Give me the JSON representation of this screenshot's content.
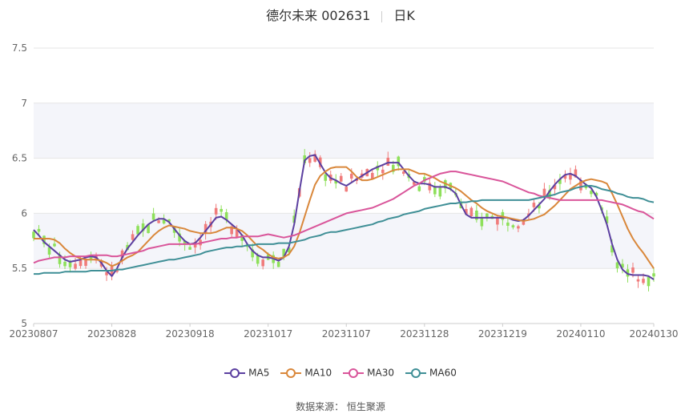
{
  "title": {
    "name": "德尔未来 002631",
    "period": "日K"
  },
  "source": "数据来源： 恒生聚源",
  "colors": {
    "up": "#f07b7b",
    "down": "#8ee05a",
    "grid": "#e6e6e6",
    "band": "#f4f5fa"
  },
  "chart_data": {
    "type": "candlestick",
    "ylim": [
      5,
      7.5
    ],
    "yticks": [
      "5",
      "5.5",
      "6",
      "6.5",
      "7",
      "7.5"
    ],
    "xtick_labels": [
      "20230807",
      "20230828",
      "20230918",
      "20231017",
      "20231107",
      "20231128",
      "20231219",
      "20240110",
      "20240130"
    ],
    "xtick_index": [
      0,
      15,
      30,
      45,
      60,
      75,
      90,
      105,
      119
    ],
    "count": 120,
    "series": [
      {
        "name": "MA5",
        "color": "#5b3fa0",
        "values": [
          5.85,
          5.8,
          5.74,
          5.7,
          5.66,
          5.62,
          5.58,
          5.56,
          5.57,
          5.58,
          5.6,
          5.61,
          5.6,
          5.55,
          5.48,
          5.43,
          5.5,
          5.6,
          5.68,
          5.74,
          5.8,
          5.85,
          5.9,
          5.93,
          5.95,
          5.95,
          5.92,
          5.86,
          5.8,
          5.75,
          5.72,
          5.73,
          5.78,
          5.84,
          5.9,
          5.96,
          5.97,
          5.94,
          5.9,
          5.86,
          5.8,
          5.72,
          5.66,
          5.62,
          5.6,
          5.6,
          5.59,
          5.57,
          5.6,
          5.7,
          5.9,
          6.2,
          6.48,
          6.52,
          6.53,
          6.45,
          6.37,
          6.32,
          6.3,
          6.27,
          6.25,
          6.28,
          6.31,
          6.34,
          6.37,
          6.4,
          6.42,
          6.44,
          6.46,
          6.46,
          6.46,
          6.4,
          6.34,
          6.29,
          6.27,
          6.27,
          6.26,
          6.24,
          6.24,
          6.24,
          6.22,
          6.18,
          6.08,
          5.99,
          5.96,
          5.96,
          5.96,
          5.96,
          5.96,
          5.96,
          5.96,
          5.96,
          5.94,
          5.93,
          5.94,
          5.98,
          6.03,
          6.08,
          6.13,
          6.2,
          6.26,
          6.31,
          6.35,
          6.36,
          6.34,
          6.3,
          6.26,
          6.23,
          6.15,
          6.03,
          5.9,
          5.72,
          5.58,
          5.49,
          5.45,
          5.44,
          5.44,
          5.44,
          5.43,
          5.4
        ]
      },
      {
        "name": "MA10",
        "color": "#d9873a",
        "values": [
          5.77,
          5.77,
          5.77,
          5.77,
          5.76,
          5.73,
          5.68,
          5.64,
          5.61,
          5.59,
          5.58,
          5.58,
          5.58,
          5.57,
          5.55,
          5.52,
          5.54,
          5.57,
          5.6,
          5.62,
          5.65,
          5.7,
          5.75,
          5.8,
          5.84,
          5.87,
          5.89,
          5.88,
          5.87,
          5.86,
          5.84,
          5.83,
          5.82,
          5.82,
          5.82,
          5.83,
          5.85,
          5.87,
          5.87,
          5.86,
          5.84,
          5.8,
          5.75,
          5.7,
          5.67,
          5.63,
          5.6,
          5.59,
          5.6,
          5.63,
          5.7,
          5.82,
          5.97,
          6.12,
          6.26,
          6.34,
          6.38,
          6.41,
          6.42,
          6.42,
          6.42,
          6.38,
          6.33,
          6.3,
          6.3,
          6.31,
          6.33,
          6.35,
          6.37,
          6.39,
          6.4,
          6.4,
          6.4,
          6.38,
          6.36,
          6.36,
          6.34,
          6.32,
          6.29,
          6.27,
          6.25,
          6.23,
          6.2,
          6.16,
          6.12,
          6.09,
          6.05,
          6.02,
          6.0,
          5.98,
          5.97,
          5.96,
          5.95,
          5.94,
          5.93,
          5.94,
          5.95,
          5.97,
          5.99,
          6.03,
          6.07,
          6.12,
          6.17,
          6.22,
          6.25,
          6.28,
          6.3,
          6.31,
          6.3,
          6.29,
          6.27,
          6.18,
          6.08,
          5.97,
          5.86,
          5.77,
          5.7,
          5.64,
          5.57,
          5.5
        ]
      },
      {
        "name": "MA30",
        "color": "#d9559a",
        "values": [
          5.55,
          5.57,
          5.58,
          5.59,
          5.6,
          5.6,
          5.6,
          5.61,
          5.61,
          5.61,
          5.61,
          5.62,
          5.62,
          5.62,
          5.62,
          5.61,
          5.61,
          5.62,
          5.63,
          5.64,
          5.65,
          5.66,
          5.68,
          5.69,
          5.7,
          5.71,
          5.72,
          5.72,
          5.72,
          5.72,
          5.72,
          5.72,
          5.73,
          5.74,
          5.75,
          5.76,
          5.77,
          5.77,
          5.78,
          5.78,
          5.79,
          5.79,
          5.79,
          5.79,
          5.8,
          5.81,
          5.8,
          5.79,
          5.78,
          5.79,
          5.8,
          5.82,
          5.84,
          5.86,
          5.88,
          5.9,
          5.92,
          5.94,
          5.96,
          5.98,
          6.0,
          6.01,
          6.02,
          6.03,
          6.04,
          6.05,
          6.07,
          6.09,
          6.11,
          6.13,
          6.16,
          6.19,
          6.22,
          6.25,
          6.27,
          6.3,
          6.32,
          6.34,
          6.36,
          6.37,
          6.38,
          6.38,
          6.37,
          6.36,
          6.35,
          6.34,
          6.33,
          6.32,
          6.31,
          6.3,
          6.29,
          6.27,
          6.25,
          6.23,
          6.21,
          6.19,
          6.18,
          6.16,
          6.15,
          6.14,
          6.13,
          6.12,
          6.12,
          6.12,
          6.12,
          6.12,
          6.12,
          6.12,
          6.12,
          6.12,
          6.11,
          6.1,
          6.09,
          6.08,
          6.06,
          6.04,
          6.02,
          6.01,
          5.98,
          5.95
        ]
      },
      {
        "name": "MA60",
        "color": "#3f8f96",
        "values": [
          5.45,
          5.45,
          5.46,
          5.46,
          5.46,
          5.46,
          5.47,
          5.47,
          5.47,
          5.47,
          5.47,
          5.48,
          5.48,
          5.48,
          5.48,
          5.48,
          5.49,
          5.49,
          5.5,
          5.51,
          5.52,
          5.53,
          5.54,
          5.55,
          5.56,
          5.57,
          5.58,
          5.58,
          5.59,
          5.6,
          5.61,
          5.62,
          5.63,
          5.65,
          5.66,
          5.67,
          5.68,
          5.69,
          5.69,
          5.7,
          5.7,
          5.71,
          5.71,
          5.72,
          5.72,
          5.72,
          5.72,
          5.73,
          5.73,
          5.73,
          5.74,
          5.75,
          5.76,
          5.78,
          5.79,
          5.8,
          5.82,
          5.83,
          5.83,
          5.84,
          5.85,
          5.86,
          5.87,
          5.88,
          5.89,
          5.9,
          5.92,
          5.93,
          5.95,
          5.96,
          5.97,
          5.99,
          6.0,
          6.01,
          6.02,
          6.04,
          6.05,
          6.06,
          6.07,
          6.08,
          6.09,
          6.09,
          6.1,
          6.1,
          6.11,
          6.11,
          6.12,
          6.12,
          6.12,
          6.12,
          6.12,
          6.12,
          6.12,
          6.12,
          6.12,
          6.12,
          6.13,
          6.14,
          6.15,
          6.16,
          6.17,
          6.19,
          6.2,
          6.21,
          6.23,
          6.24,
          6.25,
          6.25,
          6.24,
          6.22,
          6.21,
          6.2,
          6.18,
          6.17,
          6.15,
          6.14,
          6.14,
          6.13,
          6.11,
          6.1
        ]
      }
    ]
  }
}
